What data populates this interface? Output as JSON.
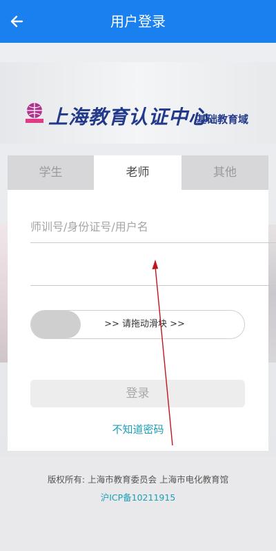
{
  "header": {
    "title": "用户登录",
    "back_icon": "arrow-left-icon"
  },
  "logo": {
    "main_text": "上海教育认证中心",
    "sub_text": "基础教育域"
  },
  "tabs": [
    {
      "label": "学生"
    },
    {
      "label": "老师"
    },
    {
      "label": "其他"
    }
  ],
  "form": {
    "username_placeholder": "师训号/身份证号/用户名",
    "username_value": "",
    "password_placeholder": "",
    "password_value": "",
    "slider_label": ">> 请拖动滑块 >>",
    "login_label": "登录",
    "forgot_label": "不知道密码"
  },
  "footer": {
    "copyright": "版权所有: 上海市教育委员会 上海市电化教育馆",
    "icp": "沪ICP备10211915"
  },
  "colors": {
    "brand_blue": "#1a80f0",
    "link_teal": "#1a9fb6",
    "annotation_red": "#c0141c"
  }
}
